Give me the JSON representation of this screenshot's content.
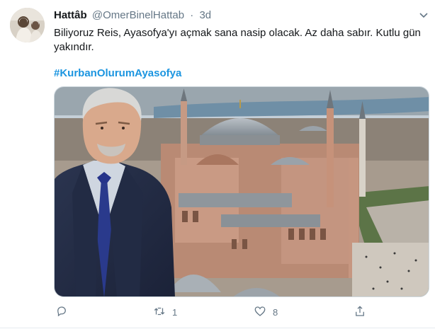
{
  "tweet": {
    "display_name": "Hattâb",
    "handle": "@OmerBinelHattab",
    "separator": "·",
    "time": "3d",
    "text": "Biliyoruz Reis, Ayasofya'yı açmak sana nasip olacak. Az daha sabır. Kutlu gün yakındır.",
    "hashtag": "#KurbanOlurumAyasofya"
  },
  "actions": {
    "reply": {
      "icon": "reply-icon",
      "count": ""
    },
    "retweet": {
      "icon": "retweet-icon",
      "count": "1"
    },
    "like": {
      "icon": "heart-icon",
      "count": "8"
    },
    "share": {
      "icon": "share-icon",
      "count": ""
    }
  },
  "colors": {
    "link": "#1b95e0",
    "secondary_text": "#657786",
    "primary_text": "#14171a",
    "border": "#ccd6dd"
  }
}
